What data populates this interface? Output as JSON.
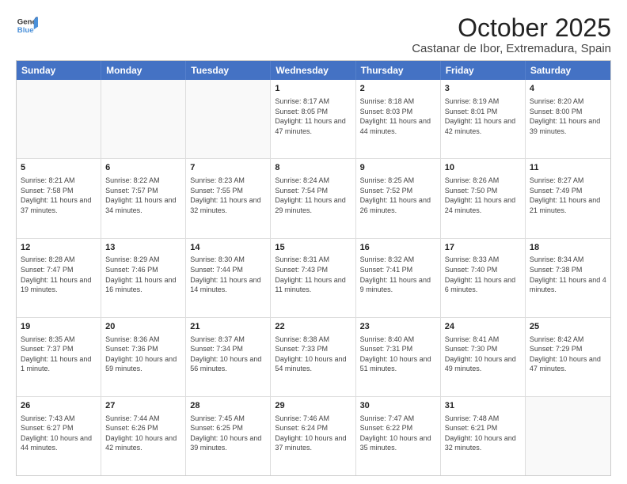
{
  "header": {
    "logo_line1": "General",
    "logo_line2": "Blue",
    "title": "October 2025",
    "subtitle": "Castanar de Ibor, Extremadura, Spain"
  },
  "calendar": {
    "days_of_week": [
      "Sunday",
      "Monday",
      "Tuesday",
      "Wednesday",
      "Thursday",
      "Friday",
      "Saturday"
    ],
    "weeks": [
      [
        {
          "day": "",
          "info": ""
        },
        {
          "day": "",
          "info": ""
        },
        {
          "day": "",
          "info": ""
        },
        {
          "day": "1",
          "info": "Sunrise: 8:17 AM\nSunset: 8:05 PM\nDaylight: 11 hours and 47 minutes."
        },
        {
          "day": "2",
          "info": "Sunrise: 8:18 AM\nSunset: 8:03 PM\nDaylight: 11 hours and 44 minutes."
        },
        {
          "day": "3",
          "info": "Sunrise: 8:19 AM\nSunset: 8:01 PM\nDaylight: 11 hours and 42 minutes."
        },
        {
          "day": "4",
          "info": "Sunrise: 8:20 AM\nSunset: 8:00 PM\nDaylight: 11 hours and 39 minutes."
        }
      ],
      [
        {
          "day": "5",
          "info": "Sunrise: 8:21 AM\nSunset: 7:58 PM\nDaylight: 11 hours and 37 minutes."
        },
        {
          "day": "6",
          "info": "Sunrise: 8:22 AM\nSunset: 7:57 PM\nDaylight: 11 hours and 34 minutes."
        },
        {
          "day": "7",
          "info": "Sunrise: 8:23 AM\nSunset: 7:55 PM\nDaylight: 11 hours and 32 minutes."
        },
        {
          "day": "8",
          "info": "Sunrise: 8:24 AM\nSunset: 7:54 PM\nDaylight: 11 hours and 29 minutes."
        },
        {
          "day": "9",
          "info": "Sunrise: 8:25 AM\nSunset: 7:52 PM\nDaylight: 11 hours and 26 minutes."
        },
        {
          "day": "10",
          "info": "Sunrise: 8:26 AM\nSunset: 7:50 PM\nDaylight: 11 hours and 24 minutes."
        },
        {
          "day": "11",
          "info": "Sunrise: 8:27 AM\nSunset: 7:49 PM\nDaylight: 11 hours and 21 minutes."
        }
      ],
      [
        {
          "day": "12",
          "info": "Sunrise: 8:28 AM\nSunset: 7:47 PM\nDaylight: 11 hours and 19 minutes."
        },
        {
          "day": "13",
          "info": "Sunrise: 8:29 AM\nSunset: 7:46 PM\nDaylight: 11 hours and 16 minutes."
        },
        {
          "day": "14",
          "info": "Sunrise: 8:30 AM\nSunset: 7:44 PM\nDaylight: 11 hours and 14 minutes."
        },
        {
          "day": "15",
          "info": "Sunrise: 8:31 AM\nSunset: 7:43 PM\nDaylight: 11 hours and 11 minutes."
        },
        {
          "day": "16",
          "info": "Sunrise: 8:32 AM\nSunset: 7:41 PM\nDaylight: 11 hours and 9 minutes."
        },
        {
          "day": "17",
          "info": "Sunrise: 8:33 AM\nSunset: 7:40 PM\nDaylight: 11 hours and 6 minutes."
        },
        {
          "day": "18",
          "info": "Sunrise: 8:34 AM\nSunset: 7:38 PM\nDaylight: 11 hours and 4 minutes."
        }
      ],
      [
        {
          "day": "19",
          "info": "Sunrise: 8:35 AM\nSunset: 7:37 PM\nDaylight: 11 hours and 1 minute."
        },
        {
          "day": "20",
          "info": "Sunrise: 8:36 AM\nSunset: 7:36 PM\nDaylight: 10 hours and 59 minutes."
        },
        {
          "day": "21",
          "info": "Sunrise: 8:37 AM\nSunset: 7:34 PM\nDaylight: 10 hours and 56 minutes."
        },
        {
          "day": "22",
          "info": "Sunrise: 8:38 AM\nSunset: 7:33 PM\nDaylight: 10 hours and 54 minutes."
        },
        {
          "day": "23",
          "info": "Sunrise: 8:40 AM\nSunset: 7:31 PM\nDaylight: 10 hours and 51 minutes."
        },
        {
          "day": "24",
          "info": "Sunrise: 8:41 AM\nSunset: 7:30 PM\nDaylight: 10 hours and 49 minutes."
        },
        {
          "day": "25",
          "info": "Sunrise: 8:42 AM\nSunset: 7:29 PM\nDaylight: 10 hours and 47 minutes."
        }
      ],
      [
        {
          "day": "26",
          "info": "Sunrise: 7:43 AM\nSunset: 6:27 PM\nDaylight: 10 hours and 44 minutes."
        },
        {
          "day": "27",
          "info": "Sunrise: 7:44 AM\nSunset: 6:26 PM\nDaylight: 10 hours and 42 minutes."
        },
        {
          "day": "28",
          "info": "Sunrise: 7:45 AM\nSunset: 6:25 PM\nDaylight: 10 hours and 39 minutes."
        },
        {
          "day": "29",
          "info": "Sunrise: 7:46 AM\nSunset: 6:24 PM\nDaylight: 10 hours and 37 minutes."
        },
        {
          "day": "30",
          "info": "Sunrise: 7:47 AM\nSunset: 6:22 PM\nDaylight: 10 hours and 35 minutes."
        },
        {
          "day": "31",
          "info": "Sunrise: 7:48 AM\nSunset: 6:21 PM\nDaylight: 10 hours and 32 minutes."
        },
        {
          "day": "",
          "info": ""
        }
      ]
    ]
  }
}
